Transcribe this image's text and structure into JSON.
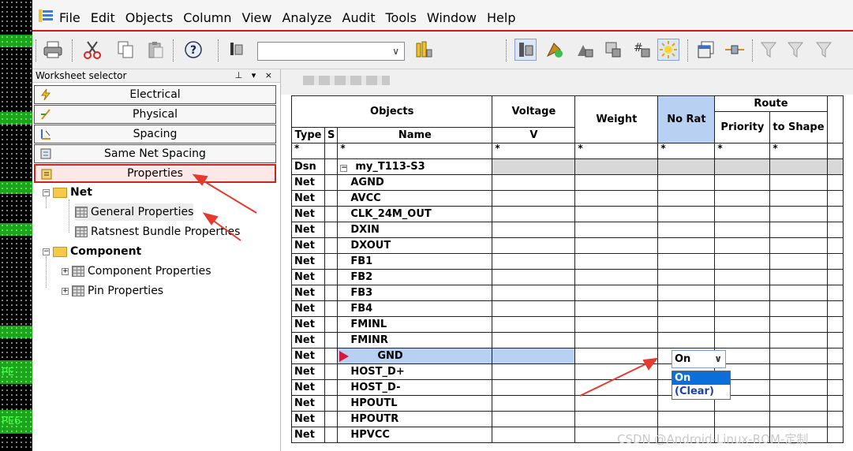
{
  "menu": [
    "File",
    "Edit",
    "Objects",
    "Column",
    "View",
    "Analyze",
    "Audit",
    "Tools",
    "Window",
    "Help"
  ],
  "pcb": {
    "label1": "PE",
    "label2": "PE6"
  },
  "worksheet": {
    "title": "Worksheet selector",
    "pin": "⊥ ▾ ×",
    "buttons": [
      "Electrical",
      "Physical",
      "Spacing",
      "Same Net Spacing",
      "Properties"
    ],
    "tree": {
      "net": "Net",
      "general": "General Properties",
      "ratsnest": "Ratsnest Bundle Properties",
      "component": "Component",
      "comp_props": "Component Properties",
      "pin_props": "Pin Properties"
    }
  },
  "grid": {
    "headers": {
      "objects": "Objects",
      "voltage": "Voltage",
      "weight": "Weight",
      "norat": "No Rat",
      "route": "Route",
      "priority": "Priority",
      "to_shape": "to Shape",
      "type": "Type",
      "s": "S",
      "name": "Name",
      "v": "V"
    },
    "filter": "*",
    "design": {
      "type": "Dsn",
      "name": "my_T113-S3"
    },
    "row_type": "Net",
    "nets": [
      "AGND",
      "AVCC",
      "CLK_24M_OUT",
      "DXIN",
      "DXOUT",
      "FB1",
      "FB2",
      "FB3",
      "FB4",
      "FMINL",
      "FMINR",
      "GND",
      "HOST_D+",
      "HOST_D-",
      "HPOUTL",
      "HPOUTR",
      "HPVCC"
    ]
  },
  "dropdown": {
    "value": "On",
    "options": [
      "On",
      "(Clear)"
    ]
  },
  "watermark": "CSDN @Android-Linux-ROM-定制"
}
